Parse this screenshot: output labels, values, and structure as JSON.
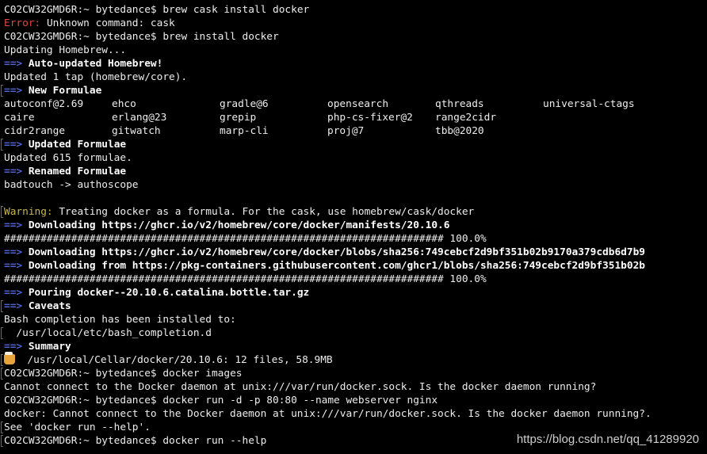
{
  "terminal": {
    "lines": [
      {
        "kind": "prompt",
        "prompt": "C02CW32GMD6R:~ bytedance$ ",
        "cmd": "brew cask install docker"
      },
      {
        "kind": "error",
        "label": "Error:",
        "text": " Unknown command: cask"
      },
      {
        "kind": "prompt",
        "prompt": "C02CW32GMD6R:~ bytedance$ ",
        "cmd": "brew install docker"
      },
      {
        "kind": "plain",
        "text": "Updating Homebrew..."
      },
      {
        "kind": "arrow",
        "arrow": "==>",
        "text": " Auto-updated Homebrew!"
      },
      {
        "kind": "plain",
        "text": "Updated 1 tap (homebrew/core)."
      },
      {
        "kind": "arrow",
        "arrow": "==>",
        "text": " New Formulae",
        "bar": true
      },
      {
        "kind": "cols",
        "cells": [
          "autoconf@2.69",
          "ehco",
          "gradle@6",
          "opensearch",
          "qthreads",
          "universal-ctags"
        ]
      },
      {
        "kind": "cols",
        "cells": [
          "caire",
          "erlang@23",
          "grepip",
          "php-cs-fixer@2",
          "range2cidr",
          ""
        ]
      },
      {
        "kind": "cols",
        "cells": [
          "cidr2range",
          "gitwatch",
          "marp-cli",
          "proj@7",
          "tbb@2020",
          ""
        ]
      },
      {
        "kind": "arrow",
        "arrow": "==>",
        "text": " Updated Formulae",
        "bar": true
      },
      {
        "kind": "plain",
        "text": "Updated 615 formulae."
      },
      {
        "kind": "arrow",
        "arrow": "==>",
        "text": " Renamed Formulae"
      },
      {
        "kind": "plain",
        "text": "badtouch -> authoscope"
      },
      {
        "kind": "plain",
        "text": ""
      },
      {
        "kind": "warning",
        "label": "Warning:",
        "text": " Treating docker as a formula. For the cask, use homebrew/cask/docker",
        "bar": true
      },
      {
        "kind": "arrow",
        "arrow": "==>",
        "text": " Downloading https://ghcr.io/v2/homebrew/core/docker/manifests/20.10.6"
      },
      {
        "kind": "plain",
        "text": "######################################################################## 100.0%"
      },
      {
        "kind": "arrow",
        "arrow": "==>",
        "text": " Downloading https://ghcr.io/v2/homebrew/core/docker/blobs/sha256:749cebcf2d9bf351b02b9170a379cdb6d7b9"
      },
      {
        "kind": "arrow",
        "arrow": "==>",
        "text": " Downloading from https://pkg-containers.githubusercontent.com/ghcr1/blobs/sha256:749cebcf2d9bf351b02b"
      },
      {
        "kind": "plain",
        "text": "######################################################################## 100.0%"
      },
      {
        "kind": "arrow",
        "arrow": "==>",
        "text": " Pouring docker--20.10.6.catalina.bottle.tar.gz"
      },
      {
        "kind": "arrow",
        "arrow": "==>",
        "text": " Caveats",
        "bar": true
      },
      {
        "kind": "plain",
        "text": "Bash completion has been installed to:"
      },
      {
        "kind": "plain",
        "text": "  /usr/local/etc/bash_completion.d",
        "bar": true
      },
      {
        "kind": "arrow",
        "arrow": "==>",
        "text": " Summary"
      },
      {
        "kind": "beer",
        "text": "  /usr/local/Cellar/docker/20.10.6: 12 files, 58.9MB",
        "bar": true
      },
      {
        "kind": "prompt",
        "prompt": "C02CW32GMD6R:~ bytedance$ ",
        "cmd": "docker images",
        "bar": true
      },
      {
        "kind": "plain",
        "text": "Cannot connect to the Docker daemon at unix:///var/run/docker.sock. Is the docker daemon running?"
      },
      {
        "kind": "prompt",
        "prompt": "C02CW32GMD6R:~ bytedance$ ",
        "cmd": "docker run -d -p 80:80 --name webserver nginx"
      },
      {
        "kind": "plain",
        "text": "docker: Cannot connect to the Docker daemon at unix:///var/run/docker.sock. Is the docker daemon running?."
      },
      {
        "kind": "plain",
        "text": "See 'docker run --help'.",
        "bar": true
      },
      {
        "kind": "prompt",
        "prompt": "C02CW32GMD6R:~ bytedance$ ",
        "cmd": "docker run --help",
        "bar": true
      }
    ]
  },
  "watermark": "https://blog.csdn.net/qq_41289920",
  "colors": {
    "error": "#e8453c",
    "arrow": "#4e63d9",
    "warning": "#c8b84a",
    "background": "#000000",
    "text": "#ededed"
  }
}
